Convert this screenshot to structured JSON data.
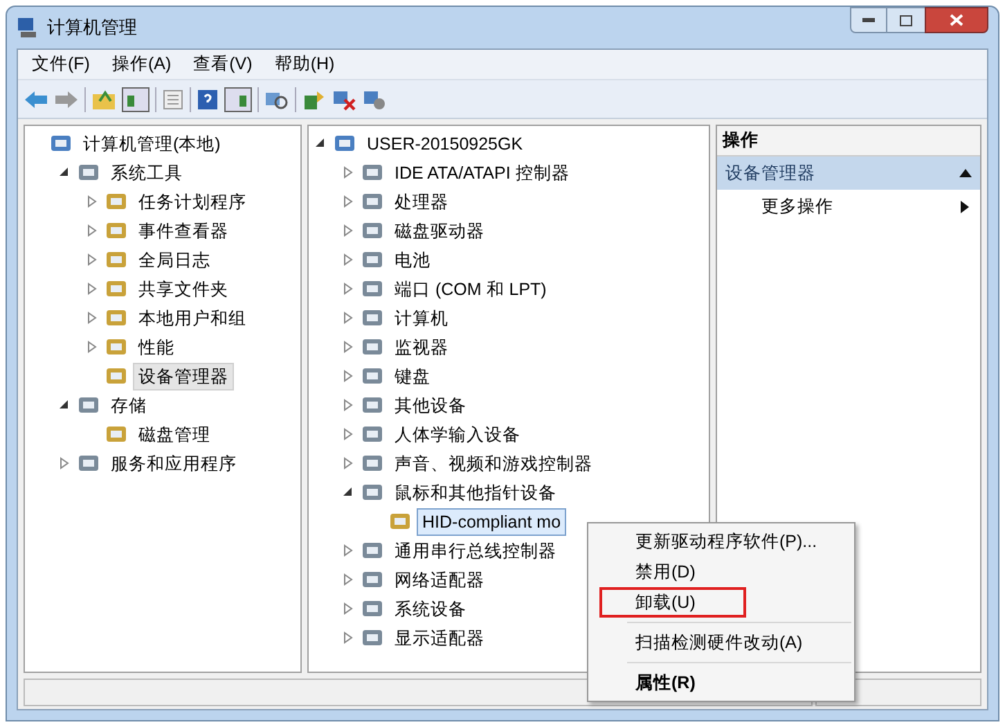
{
  "window": {
    "title": "计算机管理"
  },
  "menu_bar": [
    {
      "label": "文件(F)"
    },
    {
      "label": "操作(A)"
    },
    {
      "label": "查看(V)"
    },
    {
      "label": "帮助(H)"
    }
  ],
  "left_tree": [
    {
      "label": "计算机管理(本地)",
      "selected": false,
      "children": [
        {
          "label": "系统工具",
          "expanded": true,
          "selected": false,
          "children": [
            {
              "label": "任务计划程序",
              "expanded": false,
              "selected": false
            },
            {
              "label": "事件查看器",
              "expanded": false,
              "selected": false
            },
            {
              "label": "全局日志",
              "expanded": false,
              "selected": false
            },
            {
              "label": "共享文件夹",
              "expanded": false,
              "selected": false
            },
            {
              "label": "本地用户和组",
              "expanded": false,
              "selected": false
            },
            {
              "label": "性能",
              "expanded": false,
              "selected": false
            },
            {
              "label": "设备管理器",
              "selected": true
            }
          ]
        },
        {
          "label": "存储",
          "expanded": true,
          "selected": false,
          "children": [
            {
              "label": "磁盘管理",
              "selected": false
            }
          ]
        },
        {
          "label": "服务和应用程序",
          "expanded": false,
          "selected": false
        }
      ]
    }
  ],
  "device_tree": [
    {
      "label": "USER-20150925GK",
      "expanded": true,
      "selected": false,
      "children": [
        {
          "label": "IDE ATA/ATAPI 控制器",
          "expanded": false,
          "selected": false
        },
        {
          "label": "处理器",
          "expanded": false,
          "selected": false
        },
        {
          "label": "磁盘驱动器",
          "expanded": false,
          "selected": false
        },
        {
          "label": "电池",
          "expanded": false,
          "selected": false
        },
        {
          "label": "端口 (COM 和 LPT)",
          "expanded": false,
          "selected": false
        },
        {
          "label": "计算机",
          "expanded": false,
          "selected": false
        },
        {
          "label": "监视器",
          "expanded": false,
          "selected": false
        },
        {
          "label": "键盘",
          "expanded": false,
          "selected": false
        },
        {
          "label": "其他设备",
          "expanded": false,
          "selected": false
        },
        {
          "label": "人体学输入设备",
          "expanded": false,
          "selected": false
        },
        {
          "label": "声音、视频和游戏控制器",
          "expanded": false,
          "selected": false
        },
        {
          "label": "鼠标和其他指针设备",
          "expanded": true,
          "selected": false,
          "children": [
            {
              "label": "HID-compliant mo",
              "selected": true
            }
          ]
        },
        {
          "label": "通用串行总线控制器",
          "expanded": false,
          "selected": false
        },
        {
          "label": "网络适配器",
          "expanded": false,
          "selected": false
        },
        {
          "label": "系统设备",
          "expanded": false,
          "selected": false
        },
        {
          "label": "显示适配器",
          "expanded": false,
          "selected": false
        }
      ]
    }
  ],
  "actions_pane": {
    "title": "操作",
    "section": {
      "label": "设备管理器",
      "expanded": true
    },
    "items": [
      {
        "label": "更多操作"
      }
    ]
  },
  "context_menu": [
    {
      "kind": "item",
      "label": "更新驱动程序软件(P)...",
      "bold": false,
      "highlighted": false
    },
    {
      "kind": "item",
      "label": "禁用(D)",
      "bold": false,
      "highlighted": false
    },
    {
      "kind": "item",
      "label": "卸载(U)",
      "bold": false,
      "highlighted": true
    },
    {
      "kind": "separator"
    },
    {
      "kind": "item",
      "label": "扫描检测硬件改动(A)",
      "bold": false,
      "highlighted": false
    },
    {
      "kind": "separator"
    },
    {
      "kind": "item",
      "label": "属性(R)",
      "bold": true,
      "highlighted": false
    }
  ]
}
